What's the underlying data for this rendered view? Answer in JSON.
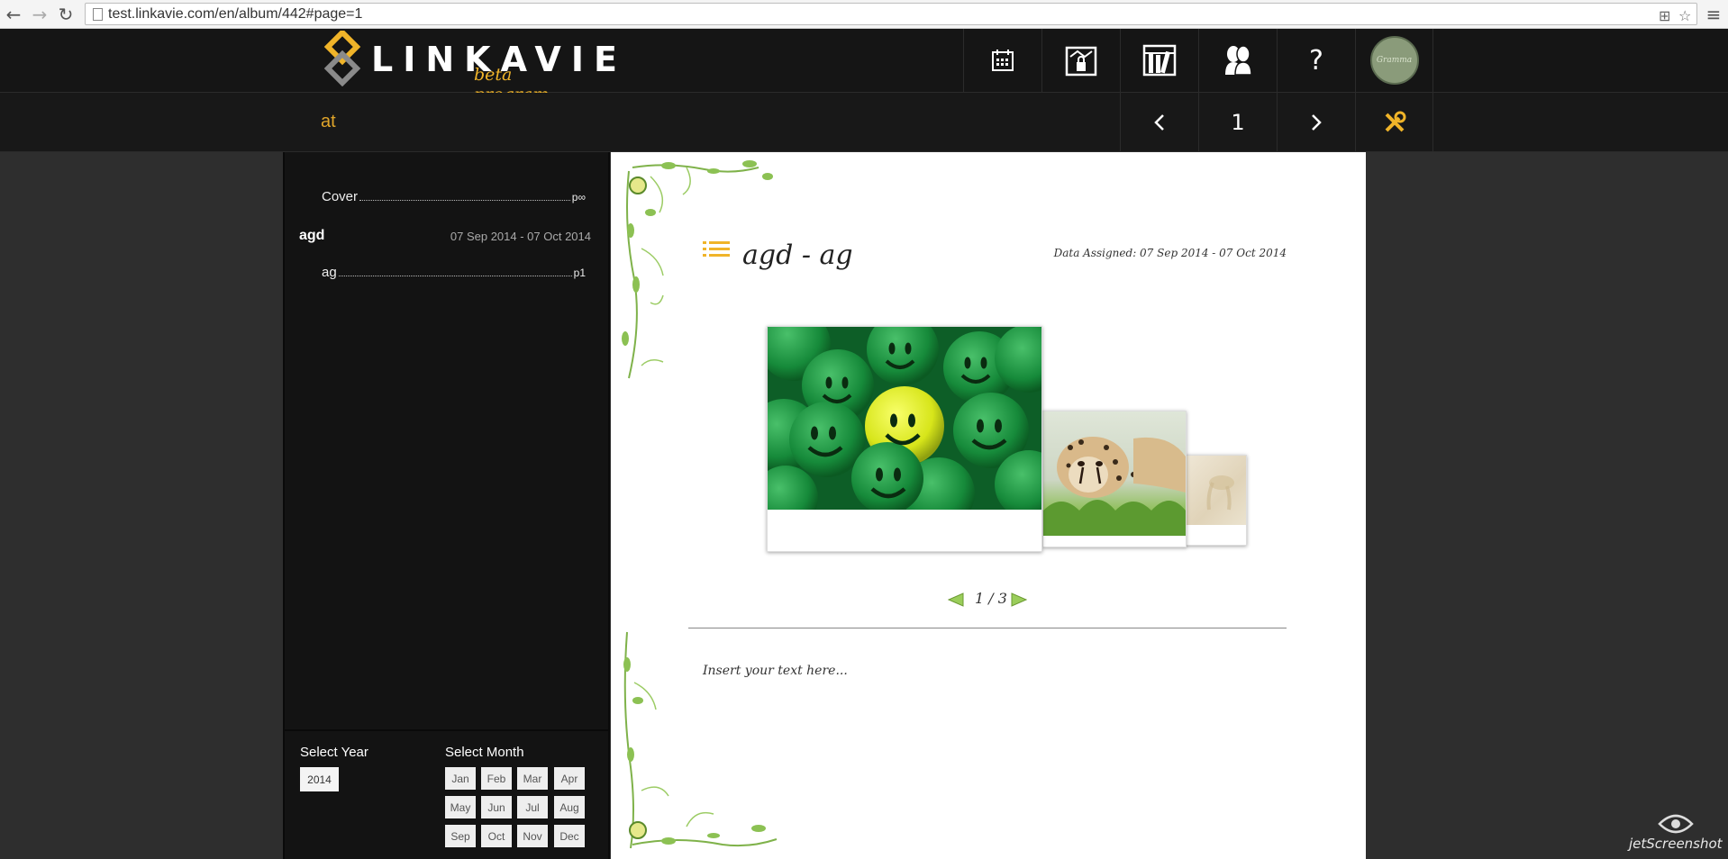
{
  "browser": {
    "url": "test.linkavie.com/en/album/442#page=1",
    "back_icon": "back-arrow-icon",
    "forward_icon": "forward-arrow-icon",
    "reload_icon": "reload-icon"
  },
  "header": {
    "logo_text": "LINKAVIE",
    "logo_sub": "beta program",
    "icons": [
      "calendar-icon",
      "album-lock-icon",
      "library-icon",
      "people-icon",
      "help-icon",
      "avatar"
    ],
    "help_label": "?",
    "avatar_text": "Gramma"
  },
  "subheader": {
    "album_title": "at",
    "page_number": "1",
    "prev_icon": "chevron-left-icon",
    "next_icon": "chevron-right-icon",
    "tools_icon": "tools-icon"
  },
  "sidebar": {
    "toc": [
      {
        "label": "Cover",
        "page": "p∞"
      },
      {
        "label": "ag",
        "page": "p1"
      }
    ],
    "section": {
      "title": "agd",
      "date": "07 Sep 2014 - 07 Oct 2014"
    },
    "select_year_label": "Select Year",
    "select_month_label": "Select Month",
    "years": [
      "2014"
    ],
    "months": [
      "Jan",
      "Feb",
      "Mar",
      "Apr",
      "May",
      "Jun",
      "Jul",
      "Aug",
      "Sep",
      "Oct",
      "Nov",
      "Dec"
    ]
  },
  "page": {
    "title": "agd - ag",
    "date_assigned": "Data Assigned: 07 Sep 2014 - 07 Oct 2014",
    "slide_counter": "1 / 3",
    "text_placeholder": "Insert your text here...",
    "photos": [
      "green-smiley-balls",
      "cheetah",
      "faded-animal"
    ]
  },
  "colors": {
    "accent": "#f0b429",
    "header_bg": "#151515",
    "page_bg": "#ffffff",
    "sidebar_bg": "#131313"
  },
  "watermark": "jetScreenshot"
}
